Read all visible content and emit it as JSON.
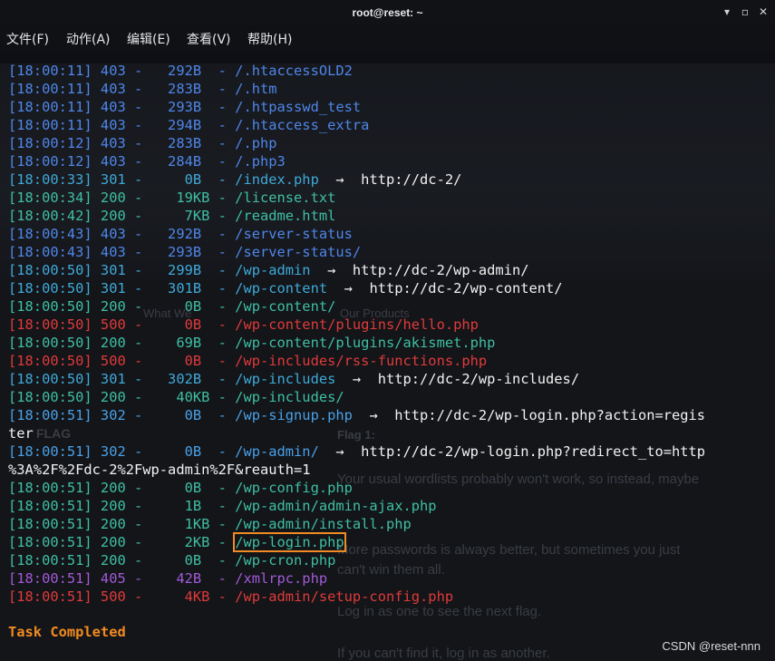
{
  "window": {
    "title": "root@reset: ~"
  },
  "menu": [
    {
      "label": "文件(F)"
    },
    {
      "label": "动作(A)"
    },
    {
      "label": "编辑(E)"
    },
    {
      "label": "查看(V)"
    },
    {
      "label": "帮助(H)"
    }
  ],
  "colors": {
    "status_403": "#4f86e8",
    "status_301": "#3fa9d8",
    "status_200": "#3fbfa3",
    "status_302": "#4aa0e6",
    "status_500": "#e03a3a",
    "status_405": "#a25ad6",
    "highlight": "#f08a24",
    "task": "#f28b21"
  },
  "lines": [
    {
      "text": "[18:00:11] 403 -   292B  - /.htaccessOLD2",
      "status": "403"
    },
    {
      "text": "[18:00:11] 403 -   283B  - /.htm",
      "status": "403"
    },
    {
      "text": "[18:00:11] 403 -   293B  - /.htpasswd_test",
      "status": "403"
    },
    {
      "text": "[18:00:11] 403 -   294B  - /.htaccess_extra",
      "status": "403"
    },
    {
      "text": "[18:00:12] 403 -   283B  - /.php",
      "status": "403"
    },
    {
      "text": "[18:00:12] 403 -   284B  - /.php3",
      "status": "403"
    },
    {
      "text": "[18:00:33] 301 -     0B  - /index.php",
      "redirect": "  →  http://dc-2/",
      "status": "301"
    },
    {
      "text": "[18:00:34] 200 -    19KB - /license.txt",
      "status": "200"
    },
    {
      "text": "[18:00:42] 200 -     7KB - /readme.html",
      "status": "200"
    },
    {
      "text": "[18:00:43] 403 -   292B  - /server-status",
      "status": "403"
    },
    {
      "text": "[18:00:43] 403 -   293B  - /server-status/",
      "status": "403"
    },
    {
      "text": "[18:00:50] 301 -   299B  - /wp-admin",
      "redirect": "  →  http://dc-2/wp-admin/",
      "status": "301"
    },
    {
      "text": "[18:00:50] 301 -   301B  - /wp-content",
      "redirect": "  →  http://dc-2/wp-content/",
      "status": "301"
    },
    {
      "text": "[18:00:50] 200 -     0B  - /wp-content/",
      "status": "200"
    },
    {
      "text": "[18:00:50] 500 -     0B  - /wp-content/plugins/hello.php",
      "status": "500"
    },
    {
      "text": "[18:00:50] 200 -    69B  - /wp-content/plugins/akismet.php",
      "status": "200"
    },
    {
      "text": "[18:00:50] 500 -     0B  - /wp-includes/rss-functions.php",
      "status": "500"
    },
    {
      "text": "[18:00:50] 301 -   302B  - /wp-includes",
      "redirect": "  →  http://dc-2/wp-includes/",
      "status": "301"
    },
    {
      "text": "[18:00:50] 200 -    40KB - /wp-includes/",
      "status": "200"
    },
    {
      "text": "[18:00:51] 302 -     0B  - /wp-signup.php",
      "redirect": "  →  http://dc-2/wp-login.php?action=regis",
      "status": "302"
    },
    {
      "text": "ter",
      "status": "cont"
    },
    {
      "text": "[18:00:51] 302 -     0B  - /wp-admin/",
      "redirect": "  →  http://dc-2/wp-login.php?redirect_to=http",
      "status": "302"
    },
    {
      "text": "%3A%2F%2Fdc-2%2Fwp-admin%2F&reauth=1",
      "status": "cont"
    },
    {
      "text": "[18:00:51] 200 -     0B  - /wp-config.php",
      "status": "200"
    },
    {
      "text": "[18:00:51] 200 -     1B  - /wp-admin/admin-ajax.php",
      "status": "200"
    },
    {
      "text": "[18:00:51] 200 -     1KB - /wp-admin/install.php",
      "status": "200"
    },
    {
      "text": "[18:00:51] 200 -     2KB - ",
      "path": "/wp-login.php",
      "status": "200",
      "highlight": true
    },
    {
      "text": "[18:00:51] 200 -     0B  - /wp-cron.php",
      "status": "200"
    },
    {
      "text": "[18:00:51] 405 -    42B  - /xmlrpc.php",
      "status": "405"
    },
    {
      "text": "[18:00:51] 500 -     4KB - /wp-admin/setup-config.php",
      "status": "500"
    }
  ],
  "task": "Task Completed",
  "watermark": "CSDN @reset-nnn",
  "background_ghost": [
    "What We",
    "Our Products",
    "Flag 1:",
    "FLAG",
    "Your usual wordlists probably won't work, so instead, maybe",
    "More passwords is always better, but sometimes you just",
    "can't win them all.",
    "Log in as one to see the next flag.",
    "If you can't find it, log in as another."
  ]
}
